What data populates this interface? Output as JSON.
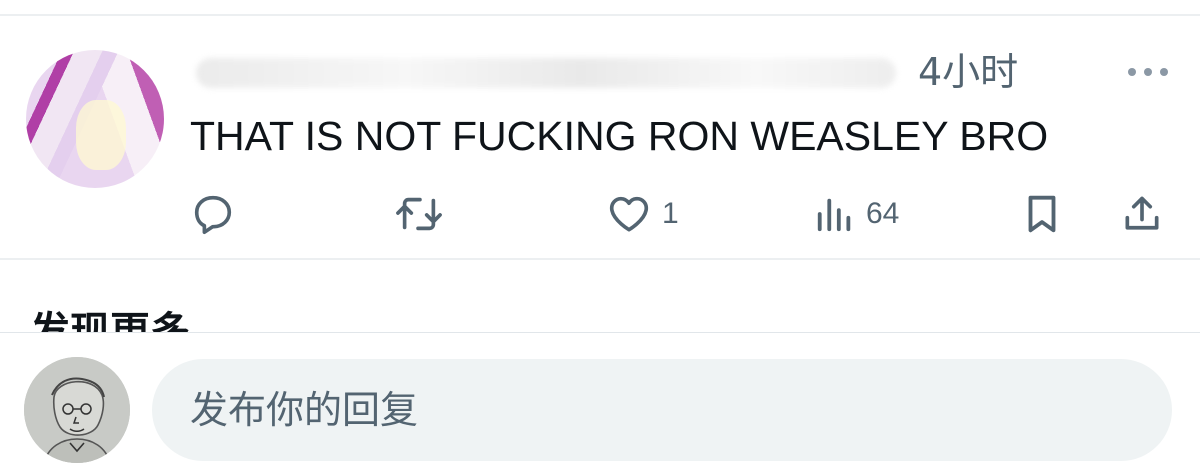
{
  "tweet": {
    "timestamp": "4小时",
    "text": "THAT IS NOT FUCKING RON WEASLEY BRO",
    "actions": {
      "reply_icon": "reply-icon",
      "retweet_icon": "retweet-icon",
      "like_icon": "heart-icon",
      "like_count": "1",
      "views_icon": "views-icon",
      "views_count": "64",
      "bookmark_icon": "bookmark-icon",
      "share_icon": "share-icon"
    },
    "more_icon": "more-dots-icon"
  },
  "section": {
    "discover_title": "发现更多"
  },
  "reply_bar": {
    "placeholder": "发布你的回复"
  },
  "colors": {
    "text": "#0f1419",
    "secondary": "#536471",
    "input_bg": "#eff3f4",
    "divider": "#eceff1"
  }
}
